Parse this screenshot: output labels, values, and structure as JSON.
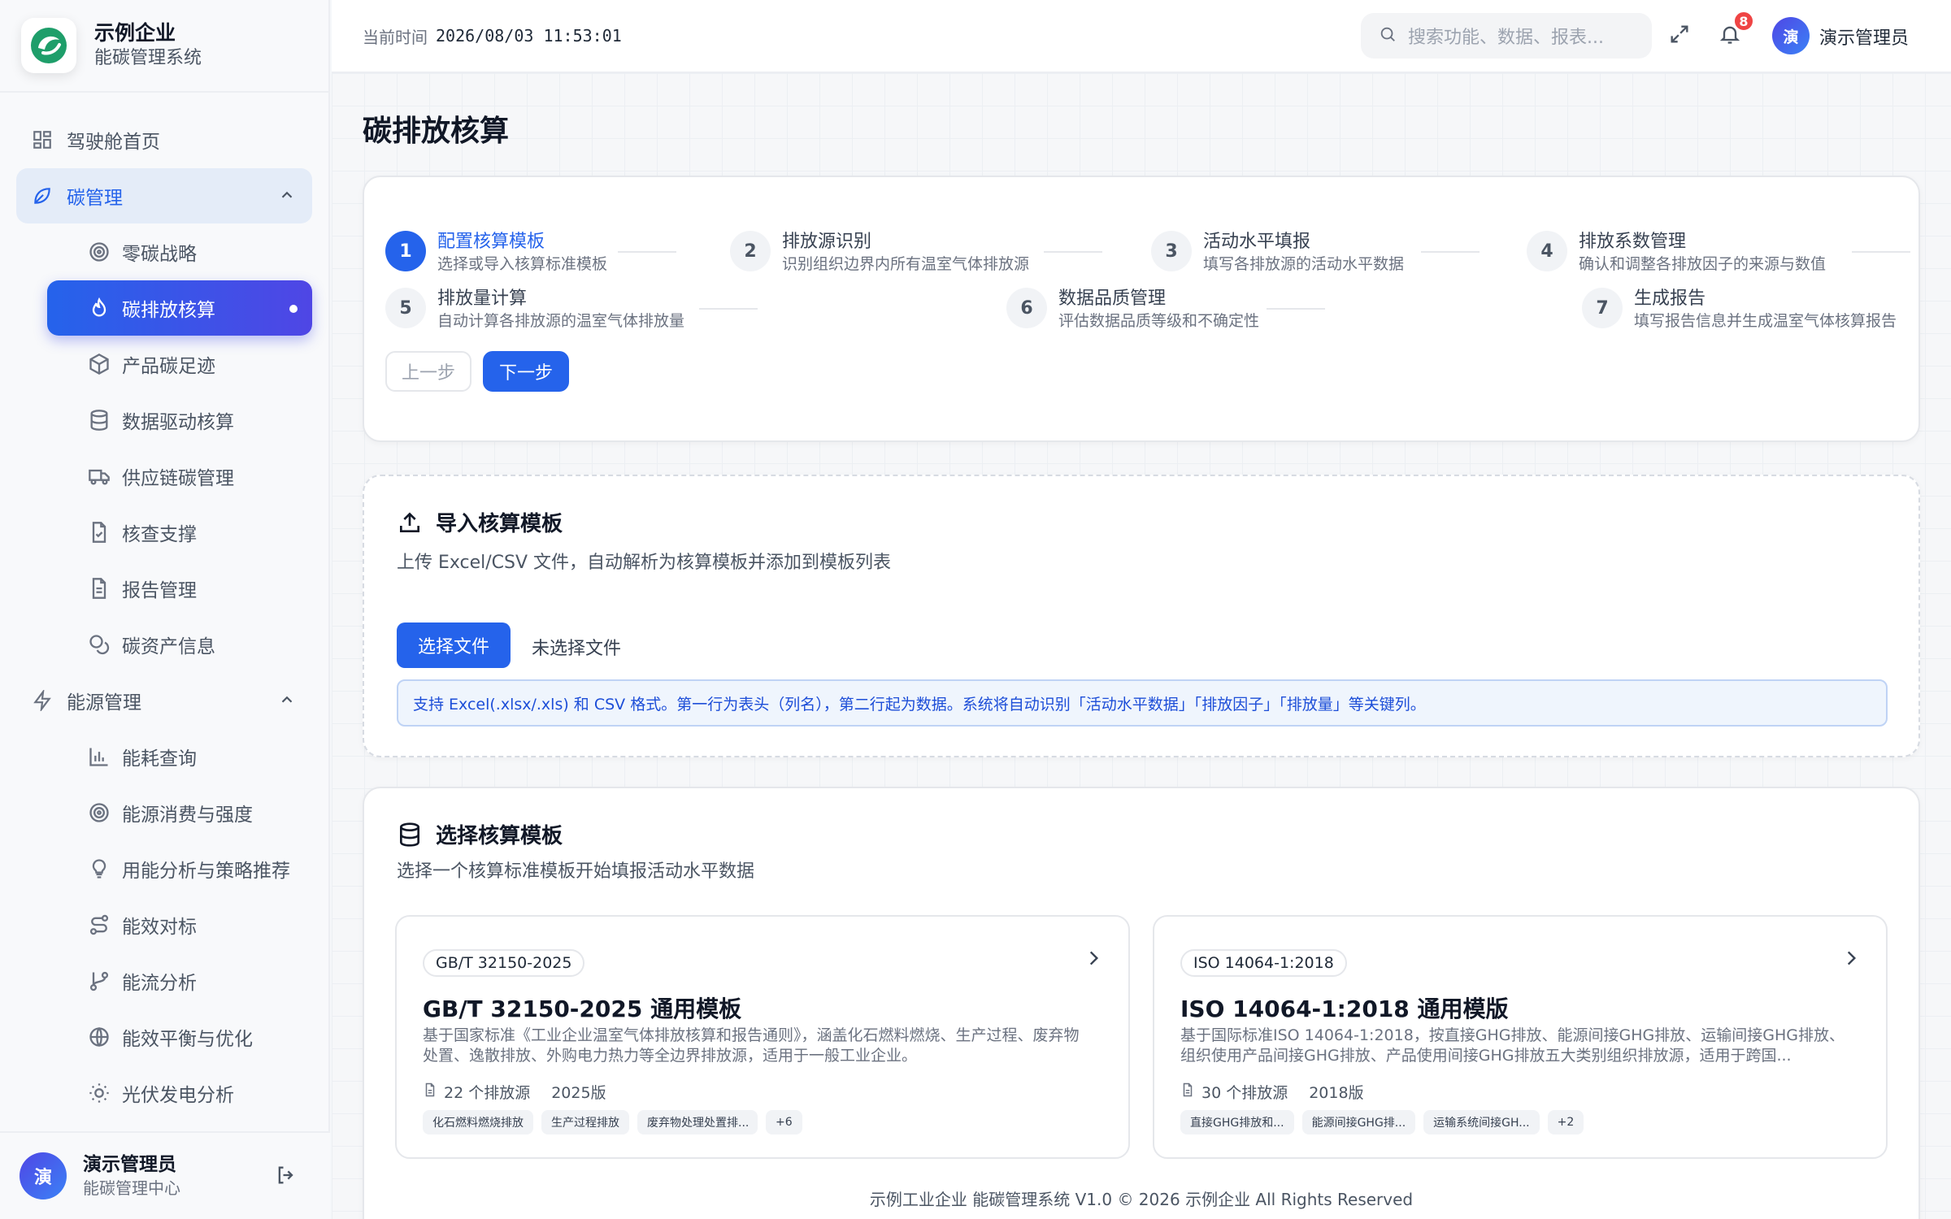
{
  "brand": {
    "name": "示例企业",
    "subtitle": "能碳管理系统"
  },
  "sidebar": {
    "items": [
      {
        "label": "驾驶舱首页",
        "icon": "dashboard-icon"
      },
      {
        "label": "碳管理",
        "icon": "leaf-icon",
        "expanded": true,
        "children": [
          {
            "label": "零碳战略",
            "icon": "target-icon"
          },
          {
            "label": "碳排放核算",
            "icon": "flame-icon",
            "active": true
          },
          {
            "label": "产品碳足迹",
            "icon": "box-icon"
          },
          {
            "label": "数据驱动核算",
            "icon": "database-icon"
          },
          {
            "label": "供应链碳管理",
            "icon": "truck-icon"
          },
          {
            "label": "核查支撑",
            "icon": "file-check-icon"
          },
          {
            "label": "报告管理",
            "icon": "file-text-icon"
          },
          {
            "label": "碳资产信息",
            "icon": "coins-icon"
          }
        ]
      },
      {
        "label": "能源管理",
        "icon": "zap-icon",
        "expanded": true,
        "children": [
          {
            "label": "能耗查询",
            "icon": "bar-chart-icon"
          },
          {
            "label": "能源消费与强度",
            "icon": "target-icon"
          },
          {
            "label": "用能分析与策略推荐",
            "icon": "lightbulb-icon"
          },
          {
            "label": "能效对标",
            "icon": "route-icon"
          },
          {
            "label": "能流分析",
            "icon": "git-branch-icon"
          },
          {
            "label": "能效平衡与优化",
            "icon": "globe-icon"
          },
          {
            "label": "光伏发电分析",
            "icon": "sun-icon"
          }
        ]
      }
    ]
  },
  "user": {
    "avatar": "演",
    "name": "演示管理员",
    "role": "能碳管理中心"
  },
  "topbar": {
    "time_label": "当前时间",
    "time_value": "2026/08/03 11:53:01",
    "search_placeholder": "搜索功能、数据、报表...",
    "notification_count": "8",
    "avatar": "演",
    "user_name": "演示管理员"
  },
  "page": {
    "title": "碳排放核算"
  },
  "steps": [
    {
      "num": "1",
      "title": "配置核算模板",
      "desc": "选择或导入核算标准模板",
      "active": true
    },
    {
      "num": "2",
      "title": "排放源识别",
      "desc": "识别组织边界内所有温室气体排放源"
    },
    {
      "num": "3",
      "title": "活动水平填报",
      "desc": "填写各排放源的活动水平数据"
    },
    {
      "num": "4",
      "title": "排放系数管理",
      "desc": "确认和调整各排放因子的来源与数值"
    },
    {
      "num": "5",
      "title": "排放量计算",
      "desc": "自动计算各排放源的温室气体排放量"
    },
    {
      "num": "6",
      "title": "数据品质管理",
      "desc": "评估数据品质等级和不确定性"
    },
    {
      "num": "7",
      "title": "生成报告",
      "desc": "填写报告信息并生成温室气体核算报告"
    }
  ],
  "step_buttons": {
    "prev": "上一步",
    "next": "下一步"
  },
  "import": {
    "title": "导入核算模板",
    "desc": "上传 Excel/CSV 文件，自动解析为核算模板并添加到模板列表",
    "choose_label": "选择文件",
    "no_file": "未选择文件",
    "hint": "支持 Excel(.xlsx/.xls) 和 CSV 格式。第一行为表头（列名），第二行起为数据。系统将自动识别「活动水平数据」「排放因子」「排放量」等关键列。"
  },
  "templates_section": {
    "title": "选择核算模板",
    "desc": "选择一个核算标准模板开始填报活动水平数据",
    "items": [
      {
        "badge": "GB/T 32150-2025",
        "name": "GB/T 32150-2025 通用模板",
        "desc": "基于国家标准《工业企业温室气体排放核算和报告通则》，涵盖化石燃料燃烧、生产过程、废弃物处置、逸散排放、外购电力热力等全边界排放源，适用于一般工业企业。",
        "sources": "22 个排放源",
        "version": "2025版",
        "tags": [
          "化石燃料燃烧排放",
          "生产过程排放",
          "废弃物处理处置排...",
          "+6"
        ]
      },
      {
        "badge": "ISO 14064-1:2018",
        "name": "ISO 14064-1:2018 通用模版",
        "desc": "基于国际标准ISO 14064-1:2018，按直接GHG排放、能源间接GHG排放、运输间接GHG排放、组织使用产品间接GHG排放、产品使用间接GHG排放五大类别组织排放源，适用于跨国...",
        "sources": "30 个排放源",
        "version": "2018版",
        "tags": [
          "直接GHG排放和...",
          "能源间接GHG排...",
          "运输系统间接GH...",
          "+2"
        ]
      }
    ]
  },
  "footer": "示例工业企业 能碳管理系统 V1.0 © 2026 示例企业 All Rights Reserved",
  "colors": {
    "primary": "#2563eb",
    "accent": "#4f46e5",
    "badge": "#ef4444",
    "brand_green": "#1e9e6a"
  }
}
